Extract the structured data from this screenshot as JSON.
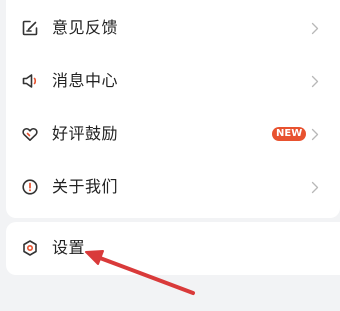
{
  "menu": {
    "items": [
      {
        "label": "意见反馈",
        "icon": "feedback-icon"
      },
      {
        "label": "消息中心",
        "icon": "speaker-icon"
      },
      {
        "label": "好评鼓励",
        "icon": "heart-icon",
        "badge": "NEW"
      },
      {
        "label": "关于我们",
        "icon": "info-icon"
      }
    ]
  },
  "settings": {
    "label": "设置",
    "icon": "settings-icon"
  },
  "colors": {
    "accent": "#e8522f",
    "annotation_arrow": "#d93a3a",
    "text": "#222222",
    "icon": "#333333",
    "chevron": "#b8b8b8",
    "background": "#f2f3f5"
  }
}
